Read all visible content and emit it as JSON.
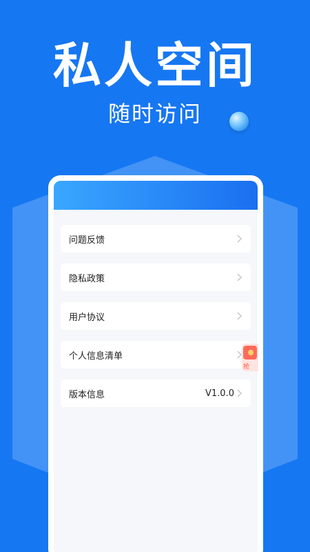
{
  "hero": {
    "title": "私人空间",
    "subtitle": "随时访问"
  },
  "menu": {
    "items": [
      {
        "label": "问题反馈",
        "value": ""
      },
      {
        "label": "隐私政策",
        "value": ""
      },
      {
        "label": "用户协议",
        "value": ""
      },
      {
        "label": "个人信息清单",
        "value": ""
      },
      {
        "label": "版本信息",
        "value": "V1.0.0"
      }
    ]
  },
  "float_badge": {
    "text": "抢",
    "icon": "red-envelope-icon"
  },
  "colors": {
    "background": "#1677f2",
    "header_gradient_start": "#3aa7ff",
    "header_gradient_end": "#1a6ff0",
    "card": "#ffffff",
    "panel": "#f5f7fb",
    "chevron": "#bfc4cc"
  }
}
